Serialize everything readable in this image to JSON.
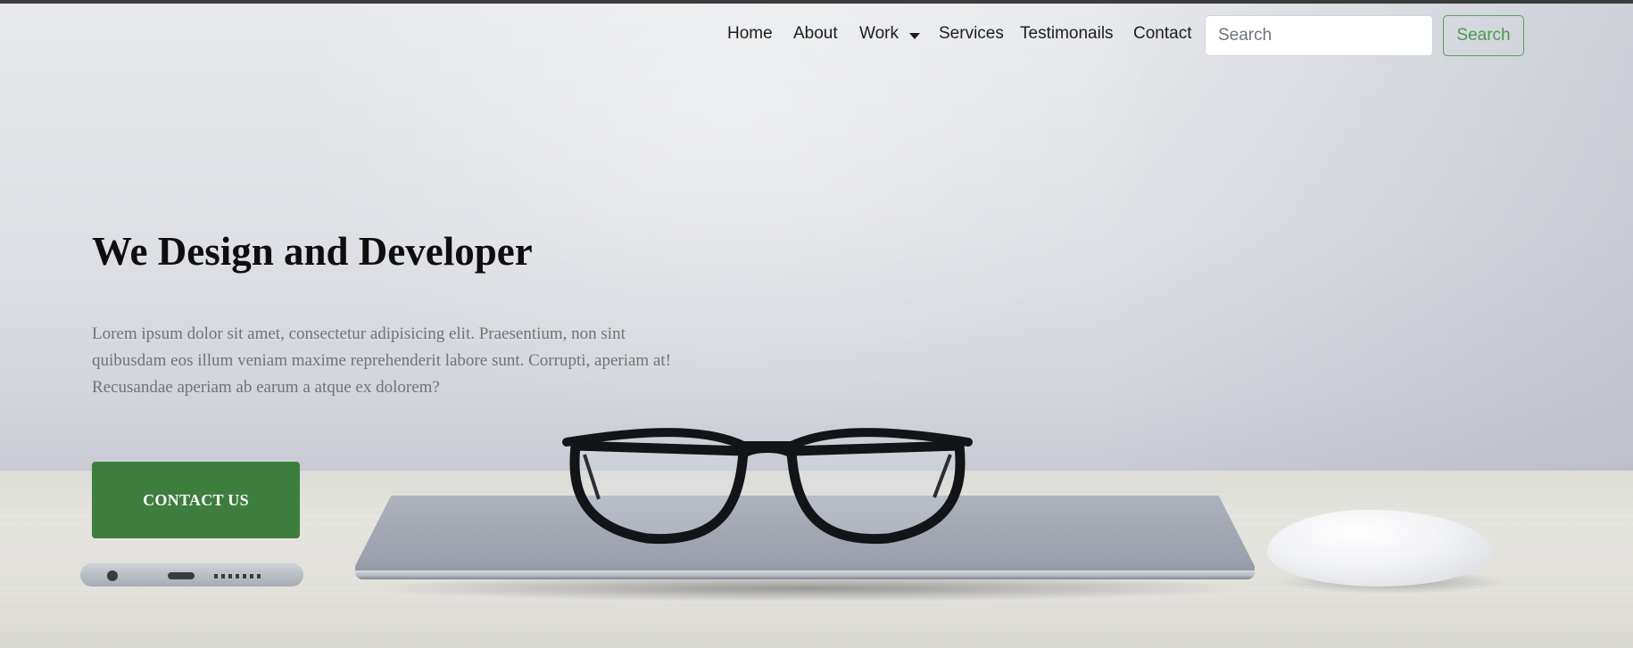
{
  "nav": {
    "items": [
      {
        "label": "Home"
      },
      {
        "label": "About"
      },
      {
        "label": "Work",
        "dropdown": true
      },
      {
        "label": "Services"
      },
      {
        "label": "Testimonails"
      },
      {
        "label": "Contact"
      }
    ],
    "search": {
      "placeholder": "Search",
      "value": ""
    },
    "search_button": "Search"
  },
  "hero": {
    "title": "We Design and Developer",
    "text": "Lorem ipsum dolor sit amet, consectetur adipisicing elit. Praesentium, non sint quibusdam eos illum veniam maxime reprehenderit labore sunt. Corrupti, aperiam at! Recusandae aperiam ab earum a atque ex dolorem?",
    "cta_label": "CONTACT US"
  },
  "colors": {
    "accent": "#3d7d3e",
    "search_button": "#4c9a52",
    "topbar": "#3b3b3b"
  },
  "icons": {
    "dropdown": "caret-down-icon"
  }
}
